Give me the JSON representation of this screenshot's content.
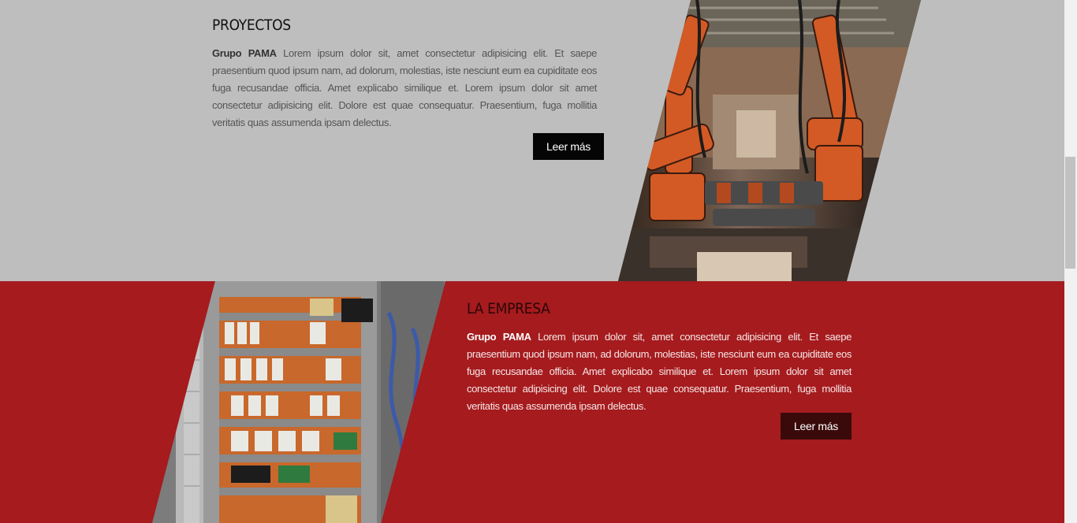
{
  "sections": {
    "proyectos": {
      "title": "PROYECTOS",
      "brand": "Grupo PAMA",
      "body": " Lorem ipsum dolor sit, amet consectetur adipisicing elit. Et saepe praesentium quod ipsum nam, ad dolorum, molestias, iste nesciunt eum ea cupiditate eos fuga recusandae officia. Amet explicabo similique et. Lorem ipsum dolor sit amet consectetur adipisicing elit. Dolore est quae consequatur. Praesentium, fuga mollitia veritatis quas assumenda ipsam delectus.",
      "button_label": "Leer más",
      "background_color": "#bebebe"
    },
    "empresa": {
      "title": "LA EMPRESA",
      "brand": "Grupo PAMA",
      "body": " Lorem ipsum dolor sit, amet consectetur adipisicing elit. Et saepe praesentium quod ipsum nam, ad dolorum, molestias, iste nesciunt eum ea cupiditate eos fuga recusandae officia. Amet explicabo similique et. Lorem ipsum dolor sit amet consectetur adipisicing elit. Dolore est quae consequatur. Praesentium, fuga mollitia veritatis quas assumenda ipsam delectus.",
      "button_label": "Leer más",
      "background_color": "#a51b1e"
    }
  },
  "colors": {
    "accent_red": "#a51b1e",
    "button_dark": "#050505",
    "button_dark_red": "#3a0a0b",
    "robot_orange": "#d35a25"
  }
}
